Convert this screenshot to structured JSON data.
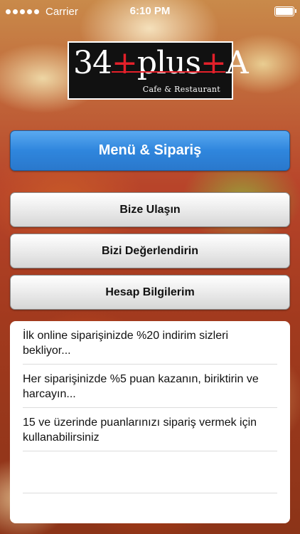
{
  "status_bar": {
    "carrier": "Carrier",
    "time": "6:10 PM",
    "battery_level": 1.0
  },
  "logo": {
    "text_main_a": "34",
    "text_main_b": "plus",
    "text_main_c": "A",
    "subtitle": "Cafe & Restaurant"
  },
  "buttons": {
    "menu_order": "Menü & Sipariş",
    "contact": "Bize Ulaşın",
    "rate": "Bizi Değerlendirin",
    "account": "Hesap Bilgilerim"
  },
  "promotions": [
    "İlk online siparişinizde %20 indirim sizleri bekliyor...",
    "Her siparişinizde %5 puan kazanın, biriktirin ve harcayın...",
    "15 ve üzerinde puanlarınızı sipariş vermek için kullanabilirsiniz"
  ],
  "colors": {
    "primary_button": "#2f86dd",
    "logo_accent": "#e3202a"
  }
}
